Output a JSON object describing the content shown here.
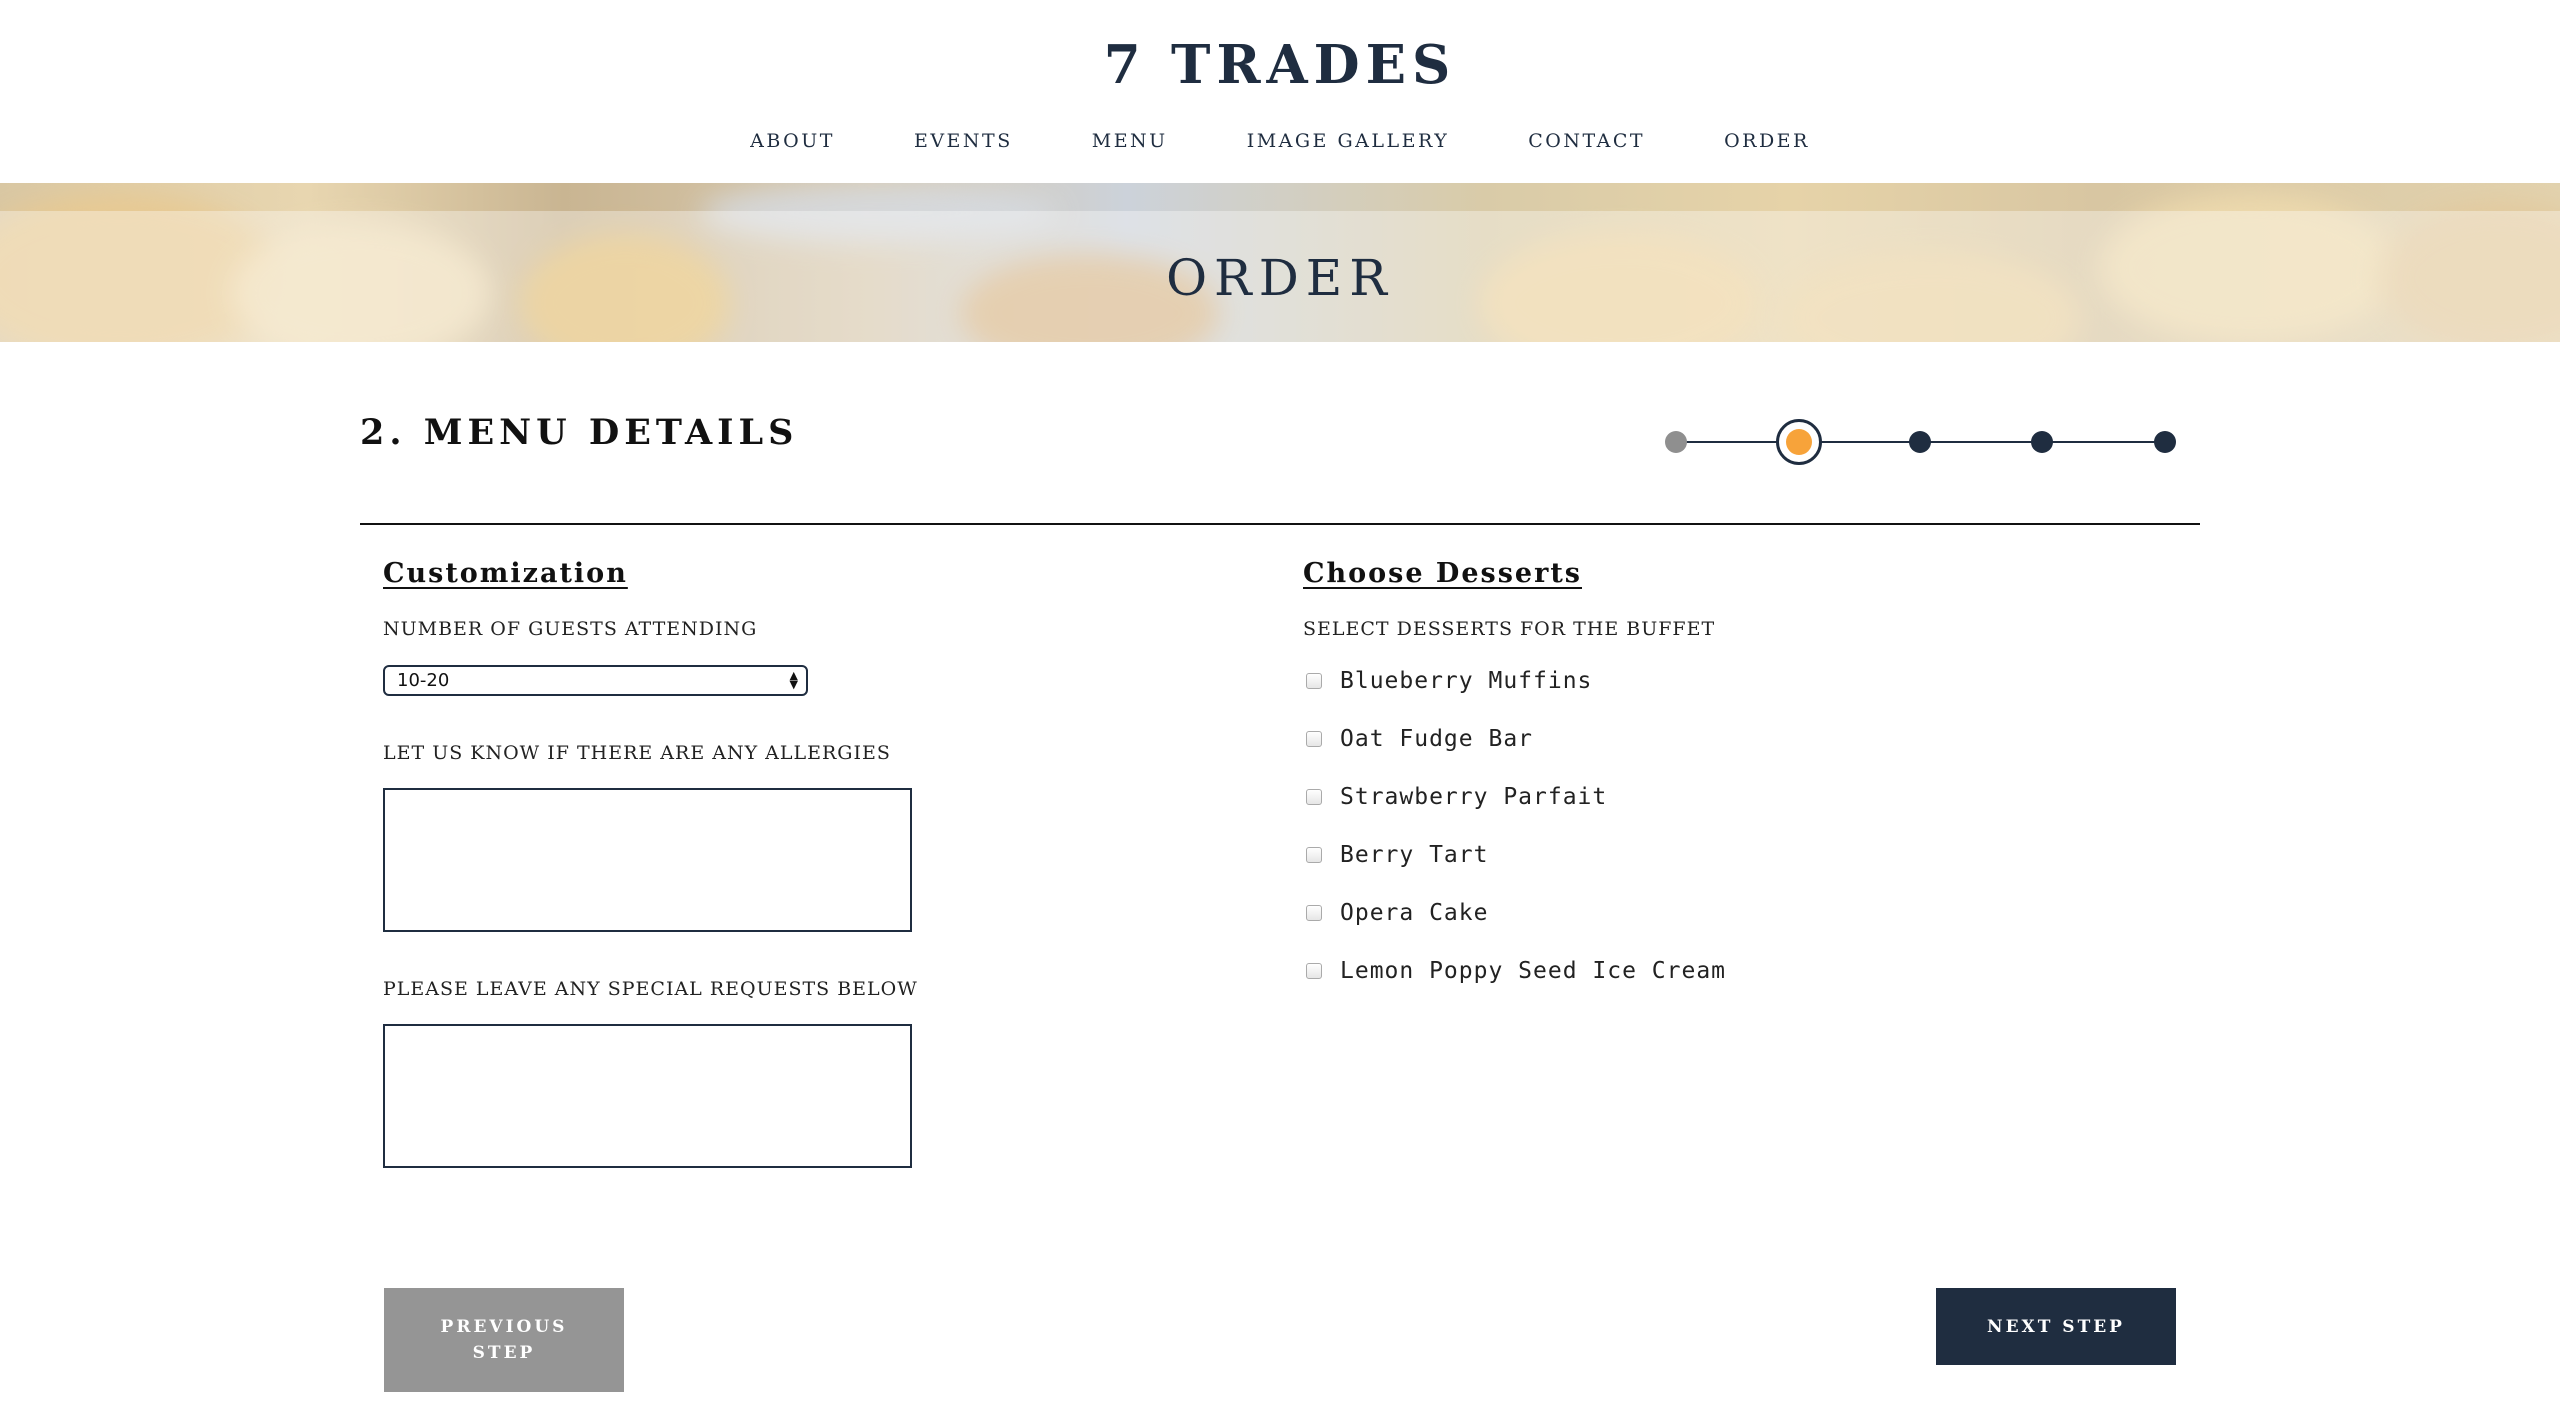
{
  "site": {
    "logo": "7 TRADES"
  },
  "nav": {
    "items": [
      {
        "label": "ABOUT"
      },
      {
        "label": "EVENTS"
      },
      {
        "label": "MENU"
      },
      {
        "label": "IMAGE GALLERY"
      },
      {
        "label": "CONTACT"
      },
      {
        "label": "ORDER"
      }
    ]
  },
  "hero": {
    "title": "ORDER"
  },
  "step": {
    "title": "2. MENU DETAILS",
    "total_steps": 5,
    "current_step": 2,
    "colors": {
      "done": "#8f8f8f",
      "current": "#f7a33a",
      "pending": "#1f2d40"
    }
  },
  "customization": {
    "heading": "Customization",
    "guests_label": "NUMBER OF GUESTS ATTENDING",
    "guests_value": "10-20",
    "allergies_label": "LET US KNOW IF THERE ARE ANY ALLERGIES",
    "allergies_value": "",
    "requests_label": "PLEASE LEAVE ANY SPECIAL REQUESTS BELOW",
    "requests_value": ""
  },
  "desserts": {
    "heading": "Choose Desserts",
    "label": "SELECT DESSERTS FOR THE BUFFET",
    "options": [
      {
        "label": "Blueberry Muffins",
        "checked": false
      },
      {
        "label": "Oat Fudge Bar",
        "checked": false
      },
      {
        "label": "Strawberry Parfait",
        "checked": false
      },
      {
        "label": "Berry Tart",
        "checked": false
      },
      {
        "label": "Opera Cake",
        "checked": false
      },
      {
        "label": "Lemon Poppy Seed Ice Cream",
        "checked": false
      }
    ]
  },
  "buttons": {
    "prev_line1": "PREVIOUS",
    "prev_line2": "STEP",
    "next": "NEXT STEP"
  },
  "colors": {
    "navy": "#1f2d40",
    "accent": "#f7a33a",
    "muted_button": "#959595"
  }
}
